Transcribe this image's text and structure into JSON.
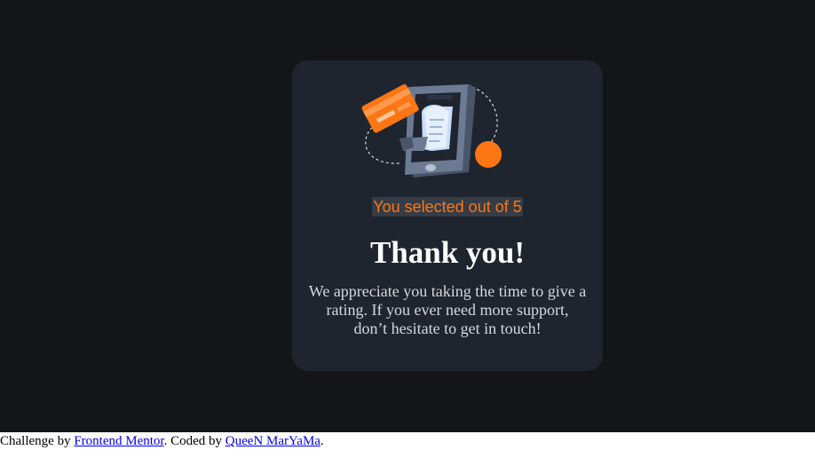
{
  "card": {
    "badge_text": "You selected out of 5",
    "title": "Thank you!",
    "message": "We appreciate you taking the time to give a rating. If you ever need more support, don’t hesitate to get in touch!",
    "illustration_icon": "payment-phone-illustration"
  },
  "attribution": {
    "prefix": "Challenge by ",
    "link1_label": "Frontend Mentor",
    "middle": ". Coded by ",
    "link2_label": "QueeN MarYaMa",
    "suffix": "."
  },
  "colors": {
    "page_background": "#131518",
    "card_background": "#1f252e",
    "accent_orange": "#fc7614",
    "badge_background": "#363c45",
    "link_blue": "#0000ee"
  }
}
